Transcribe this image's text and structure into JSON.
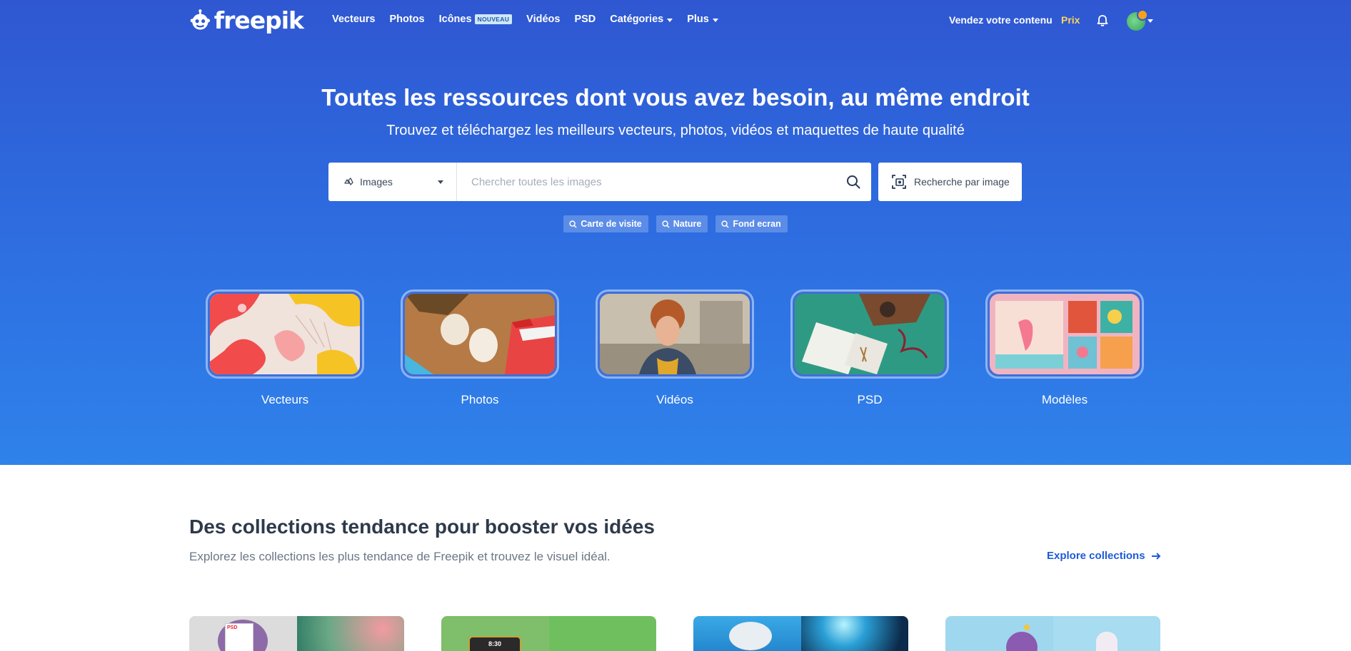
{
  "brand": {
    "name": "freepik"
  },
  "nav": {
    "items": [
      {
        "label": "Vecteurs"
      },
      {
        "label": "Photos"
      },
      {
        "label": "Icônes",
        "badge": "NOUVEAU"
      },
      {
        "label": "Vidéos"
      },
      {
        "label": "PSD"
      },
      {
        "label": "Catégories",
        "dropdown": true
      },
      {
        "label": "Plus",
        "dropdown": true
      }
    ],
    "sell_label": "Vendez votre contenu",
    "price_label": "Prix",
    "icons": {
      "notifications": "bell-icon",
      "avatar": "user-avatar"
    }
  },
  "hero": {
    "title": "Toutes les ressources dont vous avez besoin, au même endroit",
    "subtitle": "Trouvez et téléchargez les meilleurs vecteurs, photos, vidéos et maquettes de haute qualité",
    "search": {
      "type_label": "Images",
      "placeholder": "Chercher toutes les images",
      "value": "",
      "image_search_label": "Recherche par image"
    },
    "tags": [
      {
        "label": "Carte de visite"
      },
      {
        "label": "Nature"
      },
      {
        "label": "Fond ecran"
      }
    ],
    "categories": [
      {
        "label": "Vecteurs"
      },
      {
        "label": "Photos"
      },
      {
        "label": "Vidéos"
      },
      {
        "label": "PSD"
      },
      {
        "label": "Modèles"
      }
    ]
  },
  "collections": {
    "title": "Des collections tendance pour booster vos idées",
    "subtitle": "Explorez les collections les plus tendance de Freepik et trouvez le visuel idéal.",
    "explore_label": "Explore collections",
    "card_badges": {
      "psd": "PSD",
      "phone_time": "8:30"
    }
  },
  "colors": {
    "hero_top": "#2f57d2",
    "hero_bottom": "#2f82ea",
    "price": "#ffd45a",
    "link": "#1d5bd6"
  }
}
